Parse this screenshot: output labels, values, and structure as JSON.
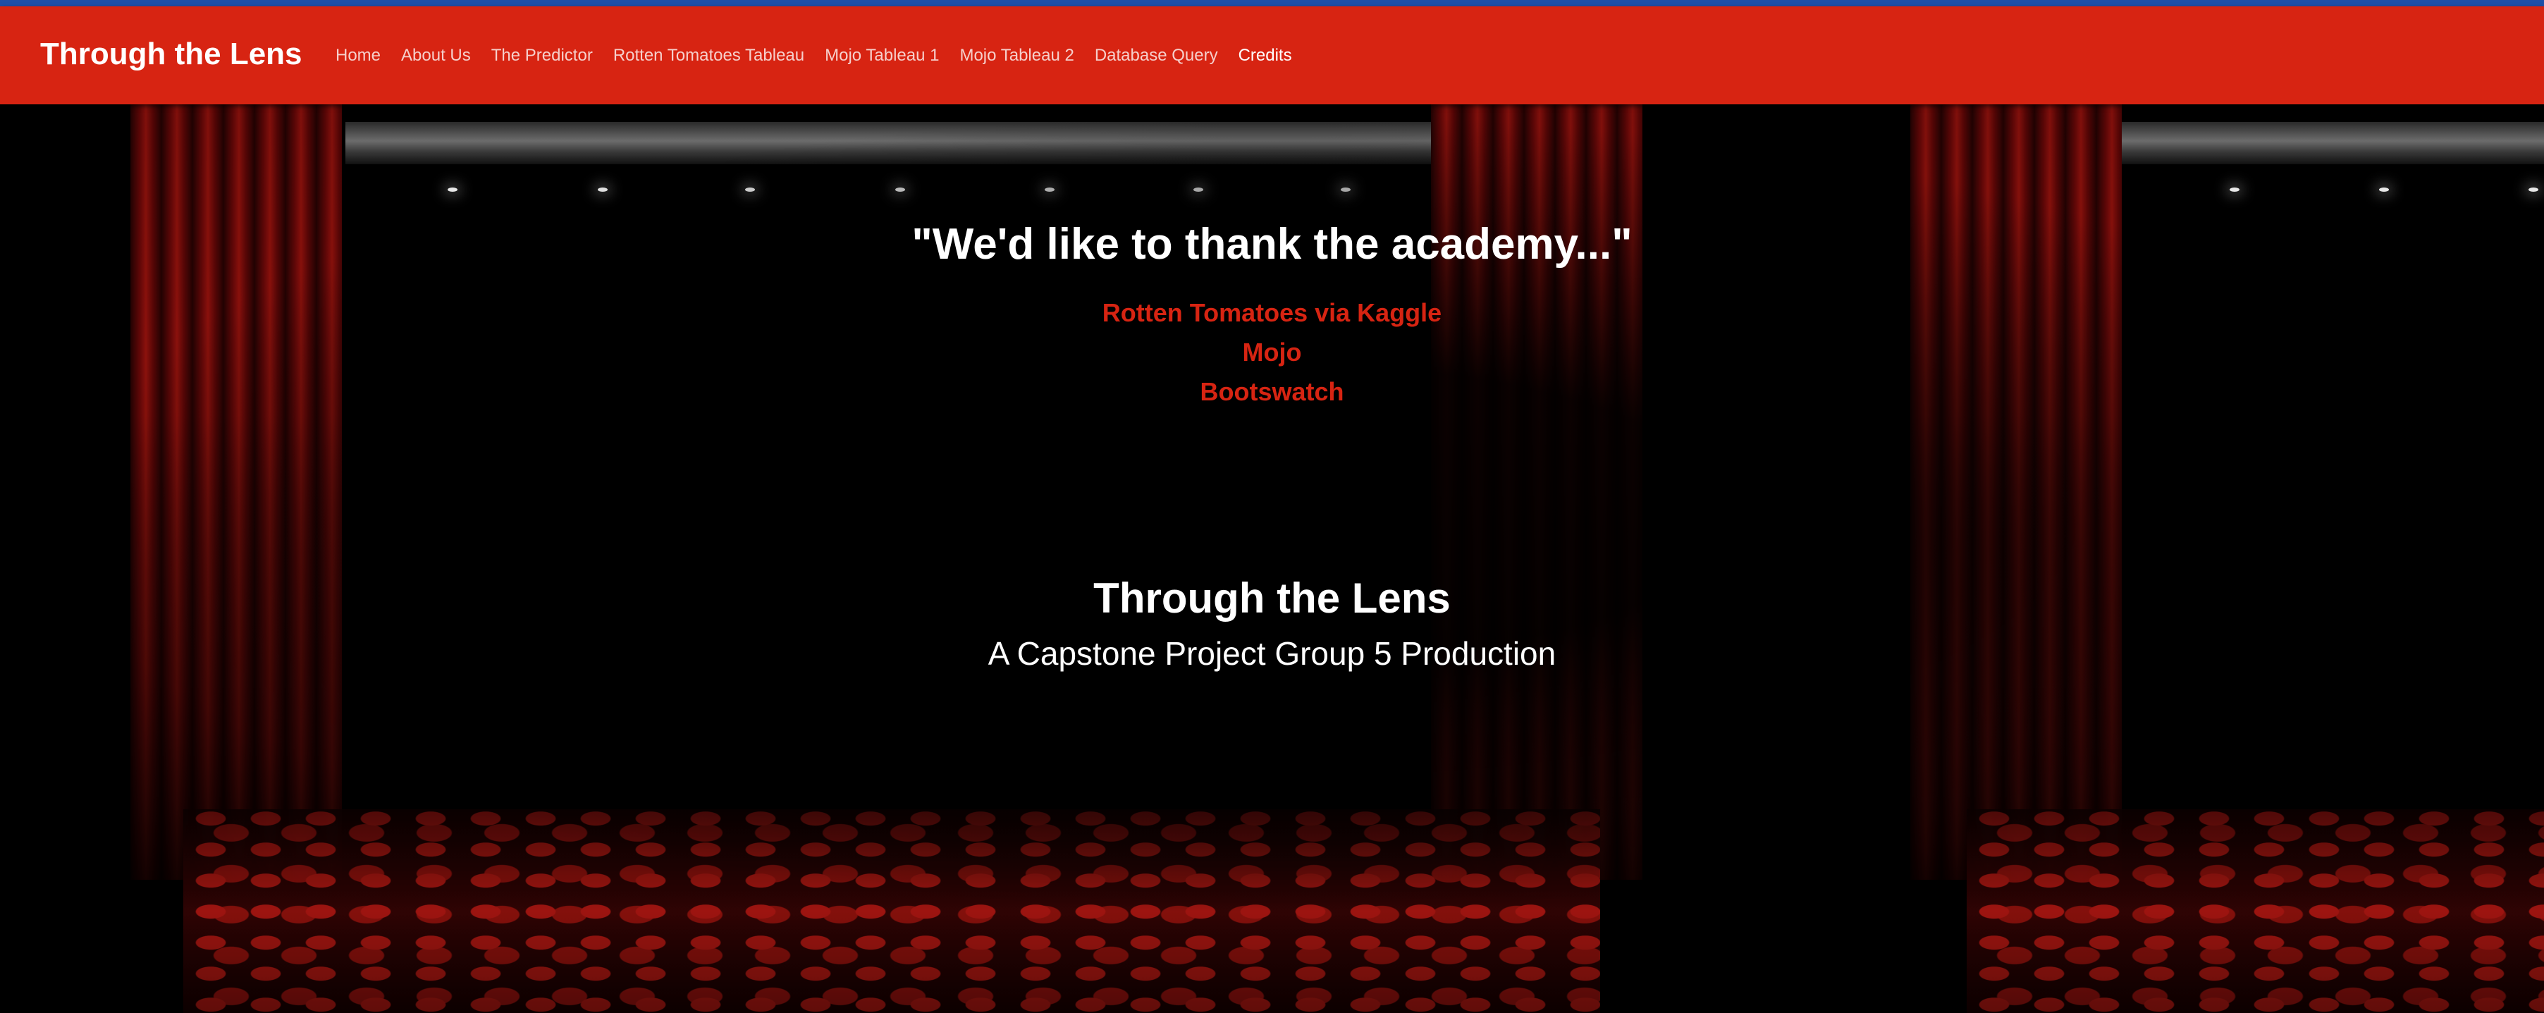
{
  "navbar": {
    "brand": "Through the Lens",
    "links": [
      {
        "label": "Home"
      },
      {
        "label": "About Us"
      },
      {
        "label": "The Predictor"
      },
      {
        "label": "Rotten Tomatoes Tableau"
      },
      {
        "label": "Mojo Tableau 1"
      },
      {
        "label": "Mojo Tableau 2"
      },
      {
        "label": "Database Query"
      },
      {
        "label": "Credits"
      }
    ],
    "active": "Credits"
  },
  "credits": {
    "heading": "\"We'd like to thank the academy...\"",
    "sources": [
      {
        "label": "Rotten Tomatoes via Kaggle"
      },
      {
        "label": "Mojo"
      },
      {
        "label": "Bootswatch"
      }
    ]
  },
  "footer": {
    "title": "Through the Lens",
    "subtitle": "A Capstone Project Group 5 Production"
  },
  "colors": {
    "navbar_bg": "#d72412",
    "topline": "#1f4fa8",
    "accent_link": "#d72412",
    "text": "#ffffff",
    "background": "#000000"
  },
  "icons": {
    "background": "theater-curtain-seats-image"
  }
}
